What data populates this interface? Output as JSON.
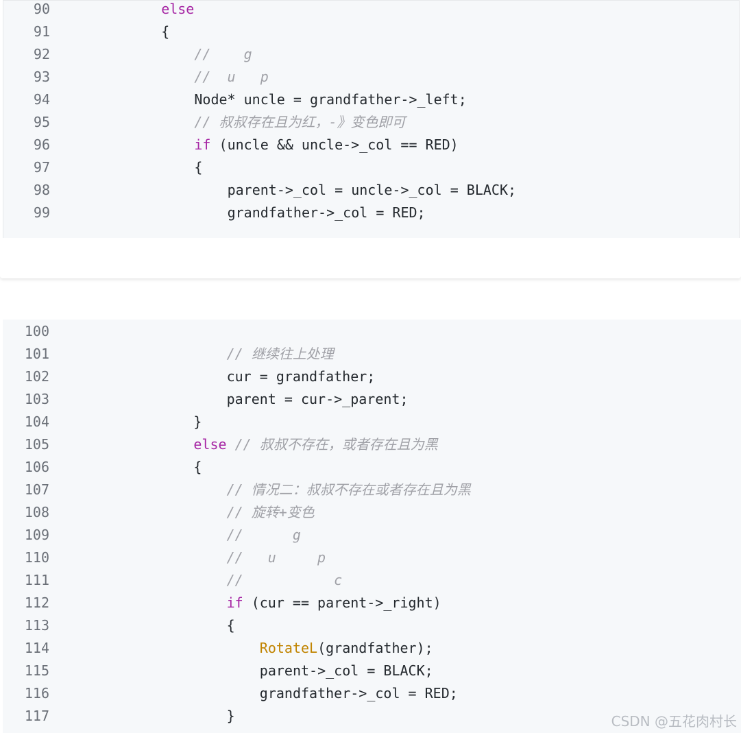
{
  "block1": {
    "lines": [
      {
        "num": "90",
        "indent": "    ",
        "parts": [
          {
            "t": "else",
            "c": "kw"
          }
        ]
      },
      {
        "num": "91",
        "indent": "    ",
        "parts": [
          {
            "t": "{",
            "c": ""
          }
        ]
      },
      {
        "num": "92",
        "indent": "        ",
        "parts": [
          {
            "t": "//    g",
            "c": "cm"
          }
        ]
      },
      {
        "num": "93",
        "indent": "        ",
        "parts": [
          {
            "t": "//  u   p",
            "c": "cm"
          }
        ]
      },
      {
        "num": "94",
        "indent": "        ",
        "parts": [
          {
            "t": "Node* uncle = grandfather->_left;",
            "c": ""
          }
        ]
      },
      {
        "num": "95",
        "indent": "        ",
        "parts": [
          {
            "t": "// 叔叔存在且为红，-》变色即可",
            "c": "cm"
          }
        ]
      },
      {
        "num": "96",
        "indent": "        ",
        "parts": [
          {
            "t": "if",
            "c": "kw"
          },
          {
            "t": " (uncle && uncle->_col == RED)",
            "c": ""
          }
        ]
      },
      {
        "num": "97",
        "indent": "        ",
        "parts": [
          {
            "t": "{",
            "c": ""
          }
        ]
      },
      {
        "num": "98",
        "indent": "            ",
        "parts": [
          {
            "t": "parent->_col = uncle->_col = BLACK;",
            "c": ""
          }
        ]
      },
      {
        "num": "99",
        "indent": "            ",
        "parts": [
          {
            "t": "grandfather->_col = RED;",
            "c": ""
          }
        ]
      }
    ]
  },
  "block2": {
    "lines": [
      {
        "num": "100",
        "indent": "",
        "parts": []
      },
      {
        "num": "101",
        "indent": "            ",
        "parts": [
          {
            "t": "// 继续往上处理",
            "c": "cm"
          }
        ]
      },
      {
        "num": "102",
        "indent": "            ",
        "parts": [
          {
            "t": "cur = grandfather;",
            "c": ""
          }
        ]
      },
      {
        "num": "103",
        "indent": "            ",
        "parts": [
          {
            "t": "parent = cur->_parent;",
            "c": ""
          }
        ]
      },
      {
        "num": "104",
        "indent": "        ",
        "parts": [
          {
            "t": "}",
            "c": ""
          }
        ]
      },
      {
        "num": "105",
        "indent": "        ",
        "parts": [
          {
            "t": "else",
            "c": "kw"
          },
          {
            "t": " // 叔叔不存在，或者存在且为黑",
            "c": "cm"
          }
        ]
      },
      {
        "num": "106",
        "indent": "        ",
        "parts": [
          {
            "t": "{",
            "c": ""
          }
        ]
      },
      {
        "num": "107",
        "indent": "            ",
        "parts": [
          {
            "t": "// 情况二：叔叔不存在或者存在且为黑",
            "c": "cm"
          }
        ]
      },
      {
        "num": "108",
        "indent": "            ",
        "parts": [
          {
            "t": "// 旋转+变色",
            "c": "cm"
          }
        ]
      },
      {
        "num": "109",
        "indent": "            ",
        "parts": [
          {
            "t": "//      g",
            "c": "cm"
          }
        ]
      },
      {
        "num": "110",
        "indent": "            ",
        "parts": [
          {
            "t": "//   u     p",
            "c": "cm"
          }
        ]
      },
      {
        "num": "111",
        "indent": "            ",
        "parts": [
          {
            "t": "//           c",
            "c": "cm"
          }
        ]
      },
      {
        "num": "112",
        "indent": "            ",
        "parts": [
          {
            "t": "if",
            "c": "kw"
          },
          {
            "t": " (cur == parent->_right)",
            "c": ""
          }
        ]
      },
      {
        "num": "113",
        "indent": "            ",
        "parts": [
          {
            "t": "{",
            "c": ""
          }
        ]
      },
      {
        "num": "114",
        "indent": "                ",
        "parts": [
          {
            "t": "RotateL",
            "c": "fn"
          },
          {
            "t": "(grandfather);",
            "c": ""
          }
        ]
      },
      {
        "num": "115",
        "indent": "                ",
        "parts": [
          {
            "t": "parent->_col = BLACK;",
            "c": ""
          }
        ]
      },
      {
        "num": "116",
        "indent": "                ",
        "parts": [
          {
            "t": "grandfather->_col = RED;",
            "c": ""
          }
        ]
      },
      {
        "num": "117",
        "indent": "            ",
        "parts": [
          {
            "t": "}",
            "c": ""
          }
        ]
      }
    ]
  },
  "watermark": "CSDN @五花肉村长",
  "colors": {
    "keyword": "#a626a4",
    "comment": "#a0a1a7",
    "function": "#c18401",
    "text": "#24292e",
    "line_number": "#6a6f77",
    "code_bg": "#f6f8fa"
  }
}
